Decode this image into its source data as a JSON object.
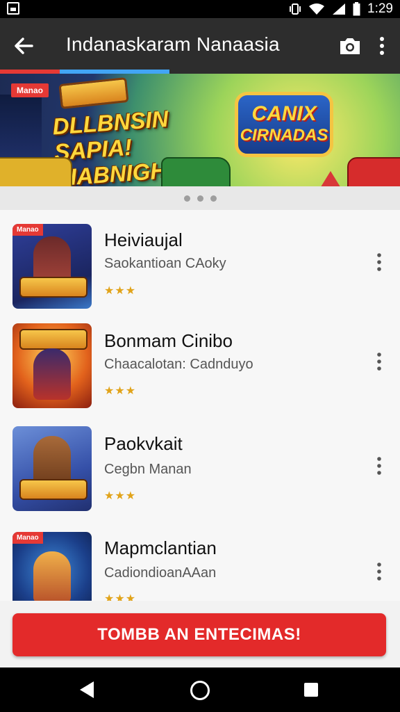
{
  "status_bar": {
    "time": "1:29",
    "icons": [
      "notification-icon",
      "vibrate-icon",
      "wifi-icon",
      "signal-icon",
      "battery-icon"
    ]
  },
  "app_bar": {
    "title": "Indanaskaram Nanaasia",
    "icons": [
      "back-arrow-icon",
      "camera-icon",
      "more-vert-icon"
    ]
  },
  "banner": {
    "badge": "Manao",
    "headline": "DLLBNSIN SAPIA! FIABNIGHA!",
    "logo_line1": "CANIX",
    "logo_line2": "CIRNADAS"
  },
  "carousel": {
    "pages": 3
  },
  "games": [
    {
      "title": "Heiviaujal",
      "subtitle": "Saokantioan CAoky",
      "stars": "★★★",
      "tag": "Manao"
    },
    {
      "title": "Bonmam Cinibo",
      "subtitle": "Chaacalotan: Cadnduyo",
      "stars": "★★★",
      "tag": ""
    },
    {
      "title": "Paokvkait",
      "subtitle": "Cegbn Manan",
      "stars": "★★★",
      "tag": ""
    },
    {
      "title": "Mapmclantian",
      "subtitle": "CadiondioanAAan",
      "stars": "★★★",
      "tag": "Manao"
    }
  ],
  "cta": {
    "label": "TOMBB AN ENTECIMAS!"
  },
  "colors": {
    "accent": "#e32a2a",
    "app_bar": "#2d2d2d",
    "progress_blue": "#42a5f5",
    "star": "#e1a319"
  }
}
